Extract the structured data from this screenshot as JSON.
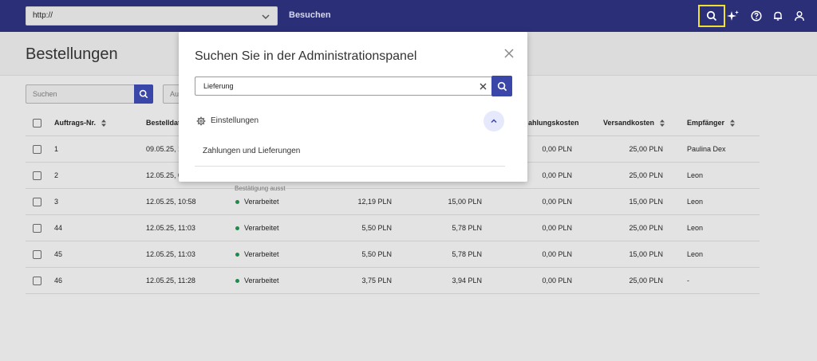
{
  "topbar": {
    "url_value": "http://",
    "visit_label": "Besuchen",
    "icons": [
      "search-icon",
      "sparkle-icon",
      "help-icon",
      "bell-icon",
      "user-icon"
    ]
  },
  "page": {
    "title": "Bestellungen",
    "search_placeholder": "Suchen",
    "filter2_placeholder": "Au"
  },
  "table": {
    "headers": {
      "order_no": "Auftrags-Nr.",
      "order_date": "Bestelldatu",
      "payment_cost": "ahlungskosten",
      "shipping_cost": "Versandkosten",
      "recipient": "Empfänger"
    },
    "rows": [
      {
        "id": "1",
        "date": "09.05.25, 1",
        "status": "",
        "net": "",
        "gross": "",
        "payment": "0,00 PLN",
        "shipping": "25,00 PLN",
        "recipient": "Paulina Dex"
      },
      {
        "id": "2",
        "date": "12.05.25, 0",
        "status": "",
        "net": "",
        "gross": "",
        "payment": "0,00 PLN",
        "shipping": "25,00 PLN",
        "recipient": "Leon",
        "subtext": "Bestätigung ausst"
      },
      {
        "id": "3",
        "date": "12.05.25, 10:58",
        "status": "Verarbeitet",
        "net": "12,19 PLN",
        "gross": "15,00 PLN",
        "payment": "0,00 PLN",
        "shipping": "15,00 PLN",
        "recipient": "Leon"
      },
      {
        "id": "44",
        "date": "12.05.25, 11:03",
        "status": "Verarbeitet",
        "net": "5,50 PLN",
        "gross": "5,78 PLN",
        "payment": "0,00 PLN",
        "shipping": "25,00 PLN",
        "recipient": "Leon"
      },
      {
        "id": "45",
        "date": "12.05.25, 11:03",
        "status": "Verarbeitet",
        "net": "5,50 PLN",
        "gross": "5,78 PLN",
        "payment": "0,00 PLN",
        "shipping": "15,00 PLN",
        "recipient": "Leon"
      },
      {
        "id": "46",
        "date": "12.05.25, 11:28",
        "status": "Verarbeitet",
        "net": "3,75 PLN",
        "gross": "3,94 PLN",
        "payment": "0,00 PLN",
        "shipping": "25,00 PLN",
        "recipient": "-"
      }
    ]
  },
  "modal": {
    "title": "Suchen Sie in der Administrationspanel",
    "search_value": "Lieferung",
    "section_label": "Einstellungen",
    "result_label": "Zahlungen und Lieferungen"
  },
  "colors": {
    "topbar": "#2a2f78",
    "accent": "#3a46a8",
    "focus_ring": "#f2e12c",
    "status_ok": "#1f8a4c"
  }
}
